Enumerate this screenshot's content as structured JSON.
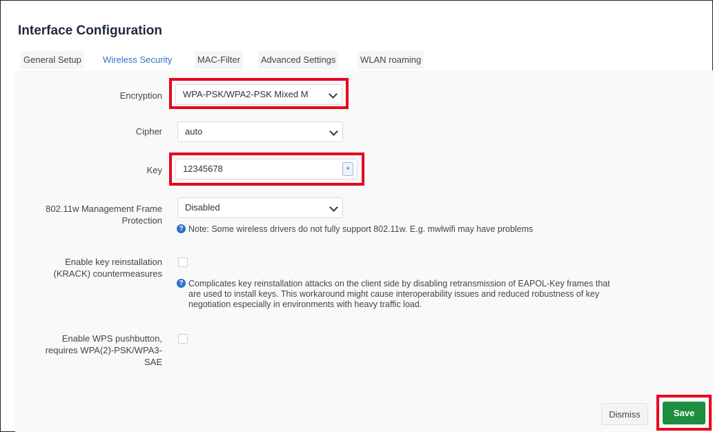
{
  "title": "Interface Configuration",
  "tabs": [
    {
      "label": "General Setup",
      "active": false
    },
    {
      "label": "Wireless Security",
      "active": true
    },
    {
      "label": "MAC-Filter",
      "active": false
    },
    {
      "label": "Advanced Settings",
      "active": false
    },
    {
      "label": "WLAN roaming",
      "active": false
    }
  ],
  "form": {
    "encryption": {
      "label": "Encryption",
      "value": "WPA-PSK/WPA2-PSK Mixed M"
    },
    "cipher": {
      "label": "Cipher",
      "value": "auto"
    },
    "key": {
      "label": "Key",
      "value": "12345678",
      "toggle": "*"
    },
    "mfp": {
      "label_line1": "802.11w Management Frame",
      "label_line2": "Protection",
      "value": "Disabled",
      "note": "Note: Some wireless drivers do not fully support 802.11w. E.g. mwlwifi may have problems"
    },
    "krack": {
      "label_line1": "Enable key reinstallation",
      "label_line2": "(KRACK) countermeasures",
      "note_line1": "Complicates key reinstallation attacks on the client side by disabling retransmission of EAPOL-Key frames that",
      "note_line2": "are used to install keys. This workaround might cause interoperability issues and reduced robustness of key",
      "note_line3": "negotiation especially in environments with heavy traffic load."
    },
    "wps": {
      "label_line1": "Enable WPS pushbutton,",
      "label_line2": "requires WPA(2)-PSK/WPA3-",
      "label_line3": "SAE"
    }
  },
  "footer": {
    "dismiss": "Dismiss",
    "save": "Save"
  },
  "colors": {
    "accent": "#2f72c4",
    "highlight": "#e8001c",
    "save": "#1e8e3e"
  },
  "icons": {
    "help": "question-circle-icon",
    "dropdown": "chevron-down-icon"
  }
}
